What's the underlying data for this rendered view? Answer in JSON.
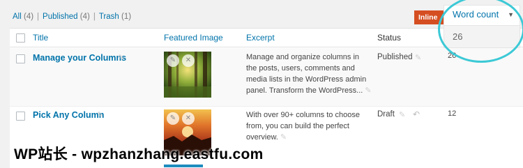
{
  "filters": {
    "all_label": "All",
    "all_count": "(4)",
    "published_label": "Published",
    "published_count": "(4)",
    "trash_label": "Trash",
    "trash_count": "(1)",
    "separator": "|"
  },
  "inline_button": {
    "label": "Inline"
  },
  "word_count_dropdown": {
    "label": "Word count",
    "value": "26"
  },
  "columns": {
    "title": "Title",
    "featured_image": "Featured Image",
    "excerpt": "Excerpt",
    "status": "Status"
  },
  "rows": [
    {
      "title": "Manage your Columns",
      "excerpt": "Manage and organize columns in the posts, users, comments and media lists in the WordPress admin panel. Transform the WordPress...",
      "status": "Published",
      "word_count": "26"
    },
    {
      "title": "Pick Any Column",
      "excerpt": "With over 90+ columns to choose from, you can build the perfect overview.",
      "status": "Draft",
      "word_count": "12"
    }
  ],
  "watermark": "WP站长 - wpzhanzhang.eastfu.com",
  "colors": {
    "link": "#0073aa",
    "inline_button_bg": "#d54e21",
    "highlight_ring": "#3cc9d6"
  }
}
